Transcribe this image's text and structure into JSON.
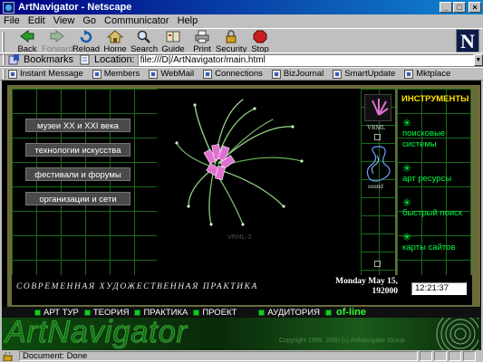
{
  "window": {
    "title": "ArtNavigator - Netscape",
    "controls": [
      "_",
      "□",
      "×"
    ]
  },
  "menubar": [
    "File",
    "Edit",
    "View",
    "Go",
    "Communicator",
    "Help"
  ],
  "toolbar": {
    "buttons": [
      {
        "label": "Back",
        "icon": "back-arrow-icon",
        "enabled": true
      },
      {
        "label": "Forward",
        "icon": "forward-arrow-icon",
        "enabled": false
      },
      {
        "label": "Reload",
        "icon": "reload-icon",
        "enabled": true
      },
      {
        "label": "Home",
        "icon": "home-icon",
        "enabled": true
      },
      {
        "label": "Search",
        "icon": "search-icon",
        "enabled": true
      },
      {
        "label": "Guide",
        "icon": "guide-icon",
        "enabled": true
      },
      {
        "label": "Print",
        "icon": "print-icon",
        "enabled": true
      },
      {
        "label": "Security",
        "icon": "security-lock-icon",
        "enabled": true
      },
      {
        "label": "Stop",
        "icon": "stop-icon",
        "enabled": true
      }
    ],
    "logo": "N"
  },
  "location": {
    "bookmarks_label": "Bookmarks",
    "location_label": "Location:",
    "url": "file:///D|/ArtNavigator/main.html"
  },
  "personal_toolbar": [
    "Instant Message",
    "Members",
    "WebMail",
    "Connections",
    "BizJournal",
    "SmartUpdate",
    "Mktplace"
  ],
  "page": {
    "left_menu": [
      "музеи XX и XXI века",
      "технологии искусства",
      "фестивали и форумы",
      "организации и сети"
    ],
    "vrml_caption": "VRML-3",
    "mid_thumbs": [
      "VRML",
      "sound"
    ],
    "tools_title": "ИНСТРУМЕНТЫ",
    "tools": [
      "поисковые системы",
      "арт ресурсы",
      "быстрый поиск",
      "карты сайтов"
    ],
    "slogan": "СОВРЕМЕННАЯ ХУДОЖЕСТВЕННАЯ ПРАКТИКА",
    "date": "Monday May 15, 192000",
    "clock": "12:21:37",
    "nav": [
      "АРТ ТУР",
      "ТЕОРИЯ",
      "ПРАКТИКА",
      "ПРОЕКТ",
      "АУДИТОРИЯ"
    ],
    "offline": "of-line",
    "brand": "ArtNavigator",
    "copyright": "Copyright 1999, 2000 (c) ArtNavigator Group"
  },
  "status": {
    "text": "Document: Done"
  },
  "colors": {
    "title_bar": "#000080",
    "tools_title": "#ffe000",
    "tool_link": "#00ff40",
    "frame_border": "#6b6b3a",
    "grid": "#1a6a1a"
  }
}
